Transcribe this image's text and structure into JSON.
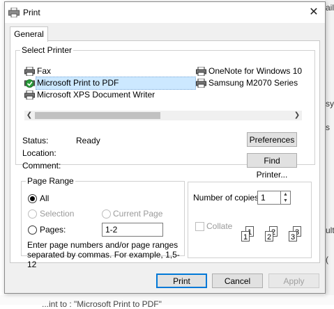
{
  "background": {
    "frag_top": "ail",
    "frag_mid1": "sy",
    "frag_mid2": "s",
    "frag_mid3": "ult",
    "frag_low": "(",
    "bottom_text": "...int to : \"Microsoft Print to PDF\""
  },
  "dialog": {
    "title": "Print",
    "close": "✕",
    "tab": "General"
  },
  "select_printer": {
    "legend": "Select Printer",
    "printers": [
      {
        "label": "Fax"
      },
      {
        "label": "Microsoft Print to PDF"
      },
      {
        "label": "Microsoft XPS Document Writer"
      },
      {
        "label": "OneNote for Windows 10"
      },
      {
        "label": "Samsung M2070 Series"
      }
    ],
    "selected": "Microsoft Print to PDF"
  },
  "status": {
    "status_label": "Status:",
    "status_value": "Ready",
    "location_label": "Location:",
    "comment_label": "Comment:",
    "preferences_btn": "Preferences",
    "find_printer_btn": "Find Printer..."
  },
  "page_range": {
    "legend": "Page Range",
    "all": "All",
    "selection": "Selection",
    "current_page": "Current Page",
    "pages": "Pages:",
    "pages_value": "1-2",
    "hint1": "Enter page numbers and/or page ranges",
    "hint2": "separated by commas.  For example, 1,5-12"
  },
  "copies": {
    "label": "Number of copies:",
    "value": "1",
    "collate": "Collate"
  },
  "buttons": {
    "print": "Print",
    "cancel": "Cancel",
    "apply": "Apply"
  },
  "colors": {
    "selection_bg": "#cce8ff",
    "default_border": "#0078d7"
  }
}
